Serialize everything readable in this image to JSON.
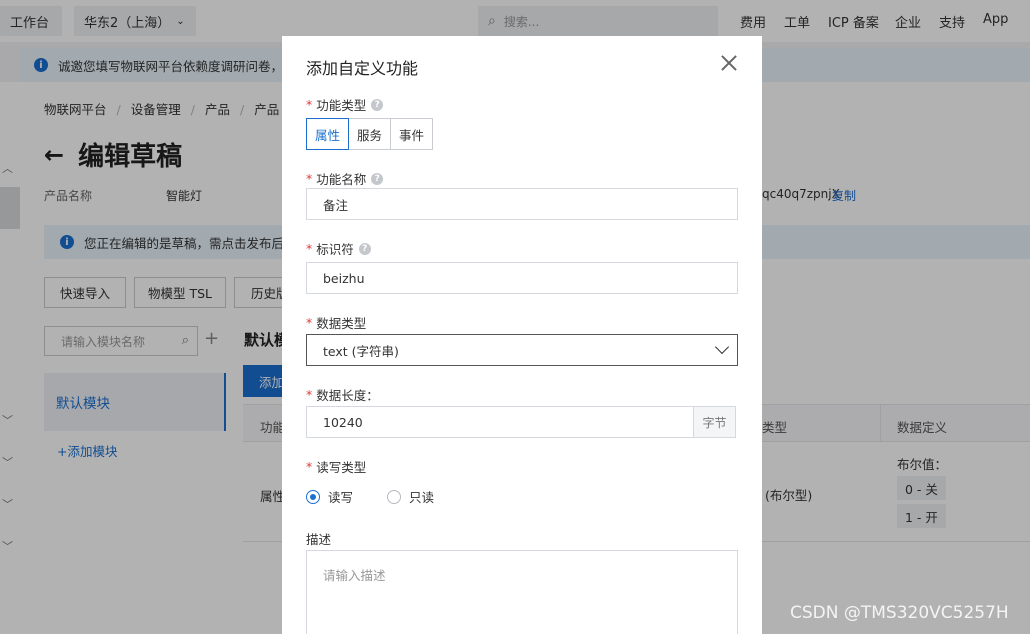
{
  "topbar": {
    "workbench": "工作台",
    "region": "华东2（上海）",
    "search_placeholder": "搜索...",
    "nav": [
      "费用",
      "工单",
      "ICP 备案",
      "企业",
      "支持",
      "App"
    ]
  },
  "banner": {
    "text": "诚邀您填写物联网平台依赖度调研问卷，有"
  },
  "breadcrumb": [
    "物联网平台",
    "设备管理",
    "产品",
    "产品"
  ],
  "page": {
    "title": "编辑草稿",
    "product_name_label": "产品名称",
    "product_name_value": "智能灯",
    "product_key_fragment": "qc40q7zpnjX",
    "copy_label": "复制"
  },
  "draft_banner": {
    "text": "您正在编辑的是草稿，需点击发布后，"
  },
  "toolbar": {
    "quick_import": "快速导入",
    "tsl": "物模型 TSL",
    "history": "历史版"
  },
  "modules": {
    "search_placeholder": "请输入模块名称",
    "default_module": "默认模块",
    "add_module": "+添加模块"
  },
  "section": {
    "title": "默认模",
    "add_button": "添加"
  },
  "table": {
    "col_function": "功能",
    "col_datatype": "类型",
    "col_definition": "数据定义",
    "row_type": "属性",
    "row_datatype": "(布尔型)",
    "bool_label": "布尔值：",
    "tags": [
      "0 - 关",
      "1 - 开"
    ]
  },
  "modal": {
    "title": "添加自定义功能",
    "function_type_label": "功能类型",
    "function_types": [
      "属性",
      "服务",
      "事件"
    ],
    "name_label": "功能名称",
    "name_value": "备注",
    "identifier_label": "标识符",
    "identifier_value": "beizhu",
    "datatype_label": "数据类型",
    "datatype_value": "text (字符串)",
    "length_label": "数据长度：",
    "length_value": "10240",
    "length_unit": "字节",
    "rw_label": "读写类型",
    "rw_options": [
      "读写",
      "只读"
    ],
    "desc_label": "描述",
    "desc_placeholder": "请输入描述"
  },
  "watermark": "CSDN @TMS320VC5257H"
}
